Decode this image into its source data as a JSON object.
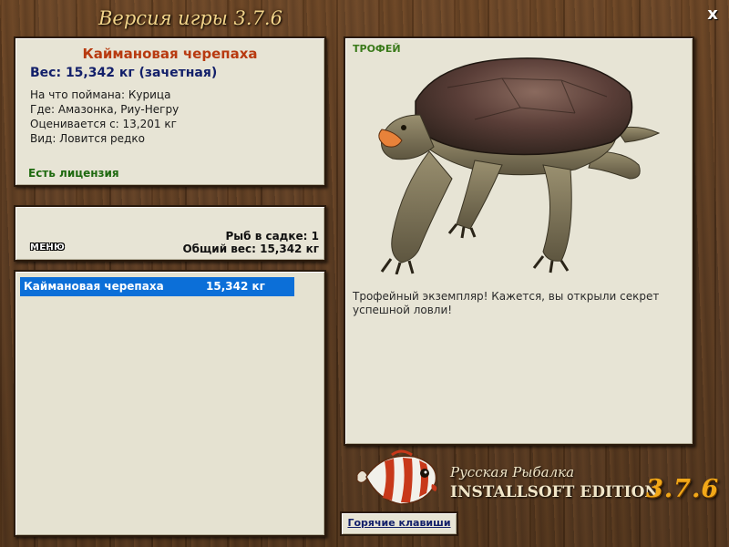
{
  "window": {
    "title": "Версия игры 3.7.6",
    "close_label": "x"
  },
  "fish": {
    "name": "Каймановая черепаха",
    "weight_line": "Вес: 15,342 кг (зачетная)",
    "bait_line": "На что поймана: Курица",
    "place_line": "Где: Амазонка, Риу-Негру",
    "rated_line": "Оценивается с: 13,201 кг",
    "kind_line": "Вид: Ловится редко",
    "license": "Есть лицензия"
  },
  "summary": {
    "menu_label": "МЕНЮ",
    "count_line": "Рыб в садке: 1",
    "total_line": "Общий вес: 15,342 кг"
  },
  "catch_list": [
    {
      "name": "Каймановая черепаха",
      "weight": "15,342 кг",
      "selected": true
    }
  ],
  "trophy": {
    "label": "ТРОФЕЙ",
    "image_icon": "turtle-icon",
    "description": "Трофейный экземпляр! Кажется, вы открыли секрет успешной ловли!"
  },
  "logo": {
    "line1": "Русская Рыбалка",
    "line2": "INSTALLSOFT EDITION",
    "version": "3.7.6",
    "icon": "fish-icon"
  },
  "hotkeys": {
    "label": "Горячие клавиши"
  },
  "colors": {
    "wood": "#5a3a1e",
    "panel": "#e7e4d5",
    "fish_name": "#b83a10",
    "weight": "#13206a",
    "license": "#1f6a10",
    "selection": "#0c6fd8",
    "version_accent": "#f2a818"
  }
}
